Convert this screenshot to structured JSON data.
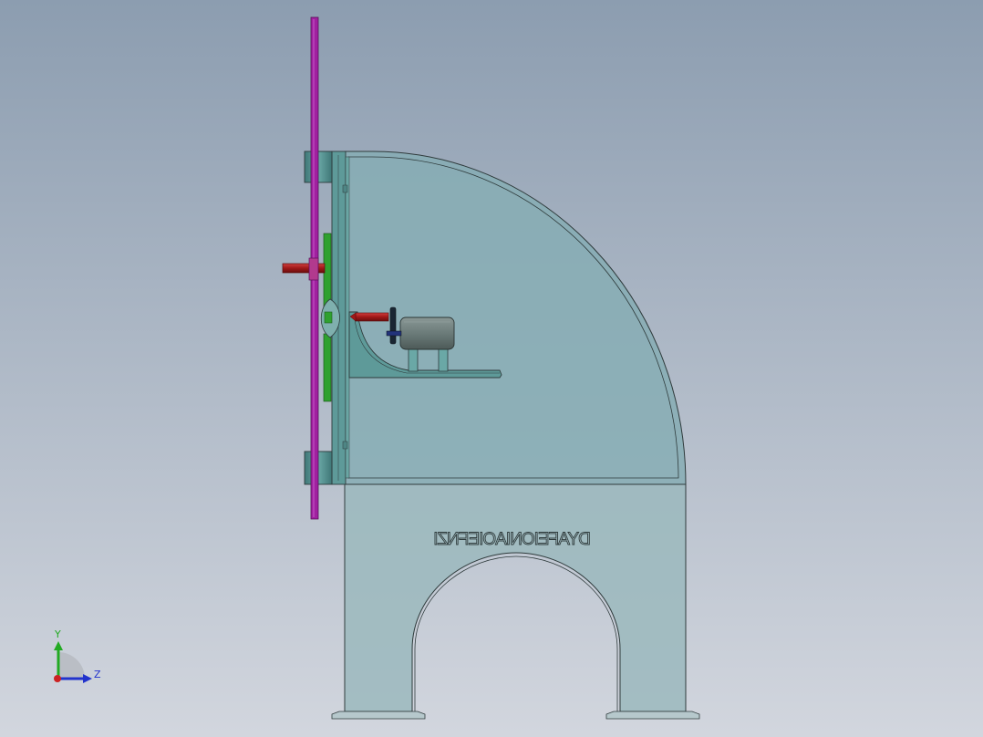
{
  "viewport": {
    "background_top": "#8c9db0",
    "background_bottom": "#d2d6de"
  },
  "model": {
    "body_fill": "#8fb3bb",
    "edge_color": "#2f3b3c",
    "frame_color": "#5e9a99",
    "rail_color": "#a020a0",
    "panel_color": "#2fa12f",
    "shaft_color": "#a01818",
    "motor_color": "#6b7b79",
    "handwheel_color": "#1a2633",
    "engraved_text": "DYAFEIONIAOIEFNZI"
  },
  "triad": {
    "y_label": "Y",
    "z_label": "Z",
    "y_color": "#22aa22",
    "z_color": "#2233cc",
    "x_color": "#cc2222"
  }
}
